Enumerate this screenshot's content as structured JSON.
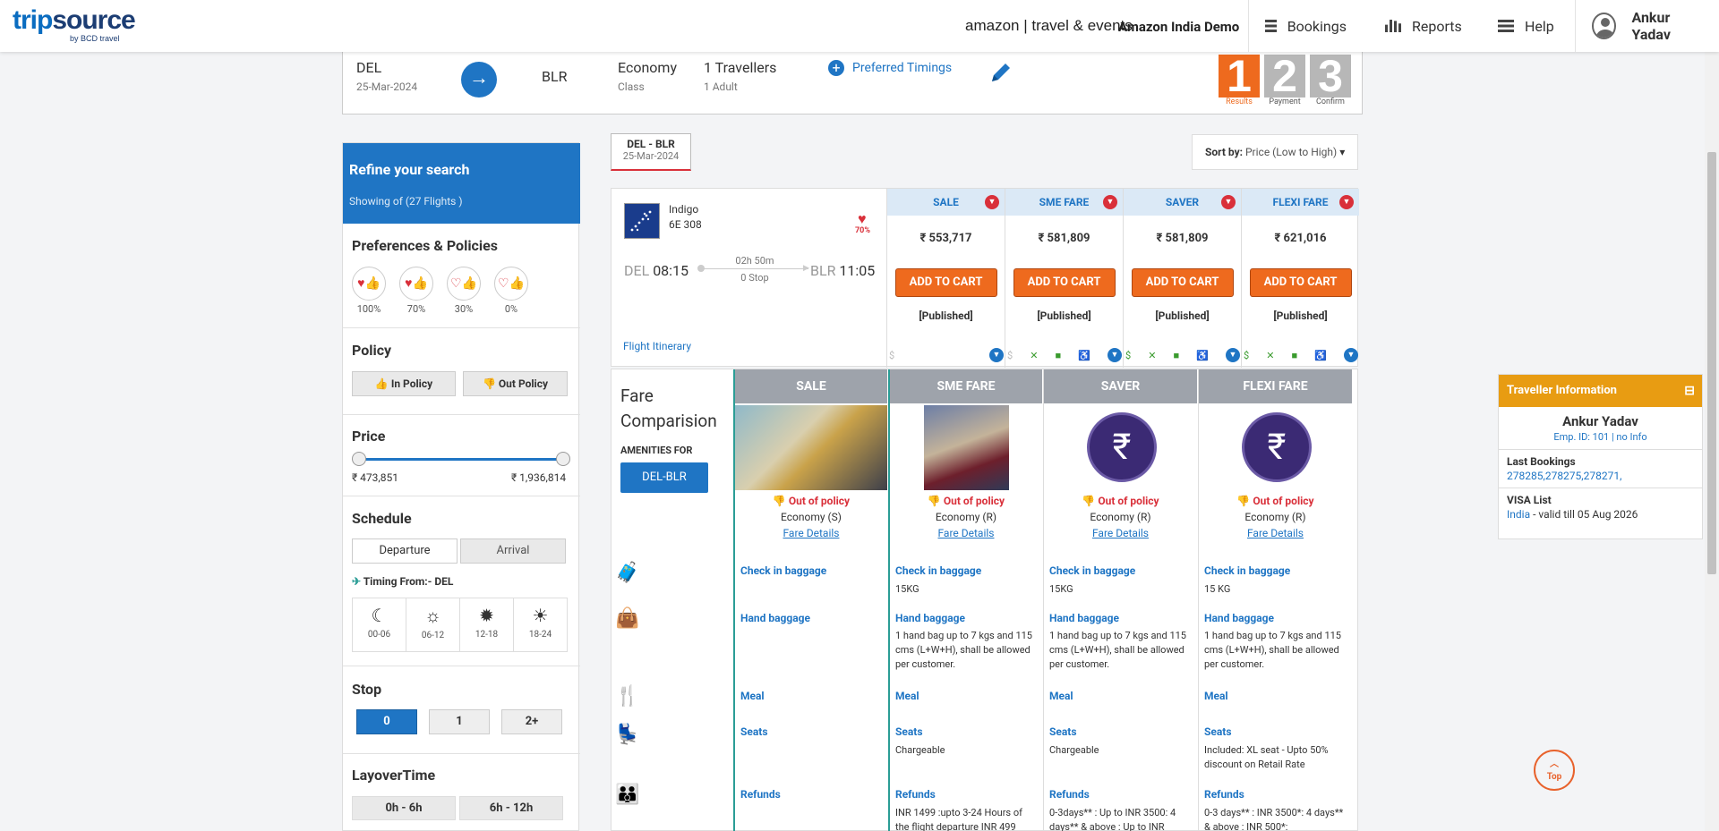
{
  "header": {
    "logo": "tripsource",
    "logo_sub": "by BCD travel",
    "amazon": "amazon | travel & events",
    "company": "Amazon India Demo",
    "nav": [
      "Bookings",
      "Reports",
      "Help"
    ],
    "user": "Ankur Yadav"
  },
  "search": {
    "from": "DEL",
    "date": "25-Mar-2024",
    "arrow": "→",
    "to": "BLR",
    "class": "Economy",
    "class_label": "Class",
    "travellers": "1 Travellers",
    "travellers_sub": "1 Adult",
    "preferred": "Preferred Timings",
    "steps": [
      {
        "num": "1",
        "label": "Results",
        "color": "#ee6a1e"
      },
      {
        "num": "2",
        "label": "Payment",
        "color": "#b7b7b7"
      },
      {
        "num": "3",
        "label": "Confirm",
        "color": "#b7b7b7"
      }
    ]
  },
  "sidebar": {
    "refine_title": "Refine your search",
    "refine_sub": "Showing of (27 Flights )",
    "prefs_title": "Preferences & Policies",
    "prefs": [
      "100%",
      "70%",
      "30%",
      "0%"
    ],
    "policy_title": "Policy",
    "in_policy": "In Policy",
    "out_policy": "Out Policy",
    "price_title": "Price",
    "price_min": "₹ 473,851",
    "price_max": "₹ 1,936,814",
    "schedule_title": "Schedule",
    "departure": "Departure",
    "arrival": "Arrival",
    "timing_from": "Timing From:- DEL",
    "timings": [
      "00-06",
      "06-12",
      "12-18",
      "18-24"
    ],
    "stop_title": "Stop",
    "stops": [
      "0",
      "1",
      "2+"
    ],
    "layover_title": "LayoverTime",
    "layovers": [
      "0h - 6h",
      "6h - 12h"
    ]
  },
  "results": {
    "route_tag": "DEL  -  BLR",
    "route_date": "25-Mar-2024",
    "sort_label": "Sort by:",
    "sort_value": "Price (Low to High)"
  },
  "flight": {
    "airline": "Indigo",
    "number": "6E  308",
    "pref_pct": "70%",
    "dep_code": "DEL",
    "dep_time": "08:15",
    "duration": "02h 50m",
    "stops": "0 Stop",
    "arr_code": "BLR",
    "arr_time": "11:05",
    "itinerary": "Flight Itinerary",
    "fares": [
      {
        "name": "SALE",
        "price": "₹ 553,717",
        "cart": "ADD TO CART",
        "type": "[Published]"
      },
      {
        "name": "SME FARE",
        "price": "₹ 581,809",
        "cart": "ADD TO CART",
        "type": "[Published]"
      },
      {
        "name": "SAVER",
        "price": "₹ 581,809",
        "cart": "ADD TO CART",
        "type": "[Published]"
      },
      {
        "name": "FLEXI FARE",
        "price": "₹ 621,016",
        "cart": "ADD TO CART",
        "type": "[Published]"
      }
    ]
  },
  "comparison": {
    "title": "Fare Comparision",
    "amenities_for": "AMENITIES FOR",
    "route_btn": "DEL-BLR",
    "cols": [
      {
        "name": "SALE",
        "policy": "Out of policy",
        "cabin": "Economy (S)",
        "details": "Fare Details",
        "checkin_h": "Check in baggage",
        "checkin": "",
        "hand_h": "Hand baggage",
        "hand": "",
        "meal_h": "Meal",
        "seats_h": "Seats",
        "seats": "",
        "refunds_h": "Refunds",
        "refunds": ""
      },
      {
        "name": "SME FARE",
        "policy": "Out of policy",
        "cabin": "Economy (R)",
        "details": "Fare Details",
        "checkin_h": "Check in baggage",
        "checkin": "15KG",
        "hand_h": "Hand baggage",
        "hand": "1 hand bag up to 7 kgs and 115 cms (L+W+H), shall be allowed per customer.",
        "meal_h": "Meal",
        "seats_h": "Seats",
        "seats": "Chargeable",
        "refunds_h": "Refunds",
        "refunds": "INR 1499 :upto 3-24 Hours of the flight departure INR 499"
      },
      {
        "name": "SAVER",
        "policy": "Out of policy",
        "cabin": "Economy (R)",
        "details": "Fare Details",
        "checkin_h": "Check in baggage",
        "checkin": "15KG",
        "hand_h": "Hand baggage",
        "hand": "1 hand bag up to 7 kgs and 115 cms (L+W+H), shall be allowed per customer.",
        "meal_h": "Meal",
        "seats_h": "Seats",
        "seats": "Chargeable",
        "refunds_h": "Refunds",
        "refunds": "0-3days** : Up to INR 3500: 4 days** & above : Up to INR"
      },
      {
        "name": "FLEXI FARE",
        "policy": "Out of policy",
        "cabin": "Economy (R)",
        "details": "Fare Details",
        "checkin_h": "Check in baggage",
        "checkin": "15 KG",
        "hand_h": "Hand baggage",
        "hand": "1 hand bag up to 7 kgs and 115 cms (L+W+H), shall be allowed per customer.",
        "meal_h": "Meal",
        "seats_h": "Seats",
        "seats": "Included: XL seat - Upto 50% discount on Retail Rate",
        "refunds_h": "Refunds",
        "refunds": "0-3 days** : INR 3500*: 4 days** & above : INR 500*:"
      }
    ]
  },
  "traveller": {
    "title": "Traveller Information",
    "name": "Ankur Yadav",
    "emp": "Emp. ID: 101 | no Info",
    "last_bookings_h": "Last Bookings",
    "last_bookings": "278285,278275,278271,",
    "visa_h": "VISA List",
    "visa_country": "India",
    "visa_rest": " - valid till 05 Aug 2026"
  },
  "top_btn": "Top"
}
